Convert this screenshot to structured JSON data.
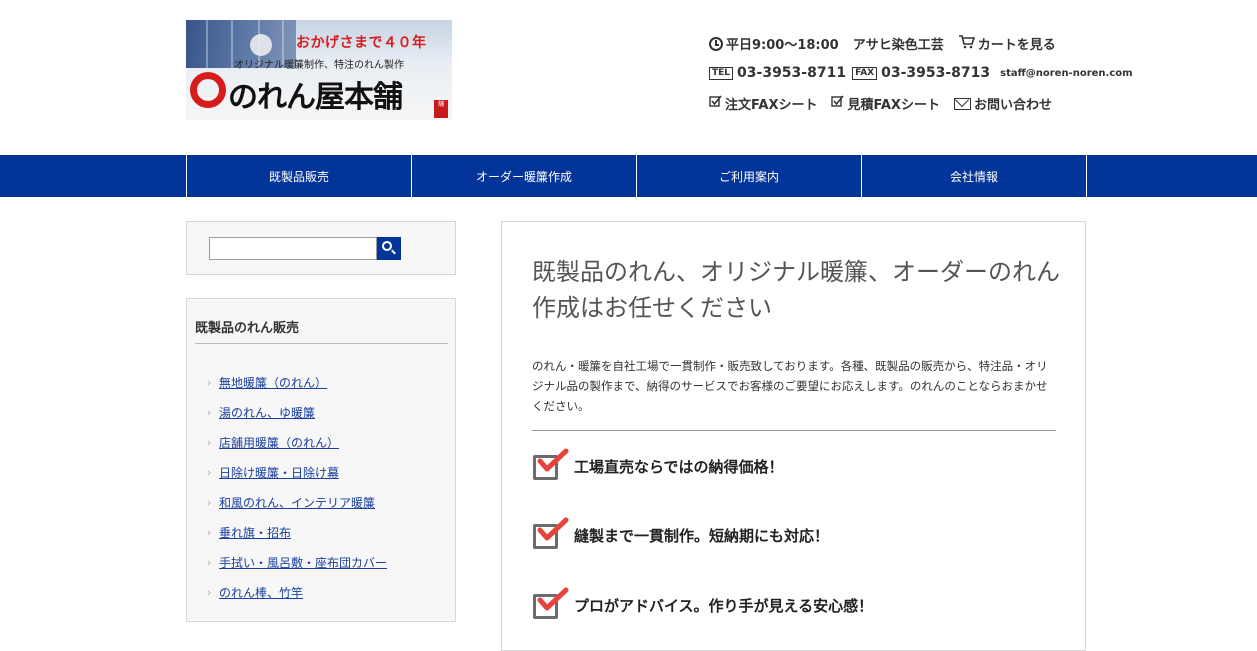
{
  "logo": {
    "tagline": "おかげさまで４０年",
    "subtitle": "オリジナル暖簾制作、特注のれん製作",
    "name": "のれん屋本舗",
    "seal": "舗"
  },
  "header": {
    "hours": "平日9:00～18:00",
    "company": "アサヒ染色工芸",
    "cart": "カートを見る",
    "tel_label": "TEL",
    "tel": "03-3953-8711",
    "fax_label": "FAX",
    "fax": "03-3953-8713",
    "email": "staff@noren-noren.com",
    "order_fax": "注文FAXシート",
    "estimate_fax": "見積FAXシート",
    "contact": "お問い合わせ"
  },
  "nav": {
    "items": [
      "既製品販売",
      "オーダー暖簾作成",
      "ご利用案内",
      "会社情報"
    ]
  },
  "search": {
    "placeholder": "",
    "value": ""
  },
  "sidebar": {
    "title": "既製品のれん販売",
    "items": [
      "無地暖簾（のれん）",
      "湯のれん、ゆ暖簾",
      "店舗用暖簾（のれん）",
      "日除け暖簾・日除け幕",
      "和風のれん、インテリア暖簾",
      "垂れ旗・招布",
      "手拭い・風呂敷・座布団カバー",
      "のれん棒、竹竿"
    ]
  },
  "main": {
    "title": "既製品のれん、オリジナル暖簾、オーダーのれん作成はお任せください",
    "body": "のれん・暖簾を自社工場で一貫制作・販売致しております。各種、既製品の販売から、特注品・オリジナル品の製作まで、納得のサービスでお客様のご要望にお応えします。のれんのことならおまかせください。",
    "features": [
      "工場直売ならではの納得価格！",
      "縫製まで一貫制作。短納期にも対応！",
      "プロがアドバイス。作り手が見える安心感！"
    ]
  },
  "colors": {
    "nav_bg": "#03349a",
    "accent_red": "#d81c1c",
    "check_red": "#e8423c"
  }
}
